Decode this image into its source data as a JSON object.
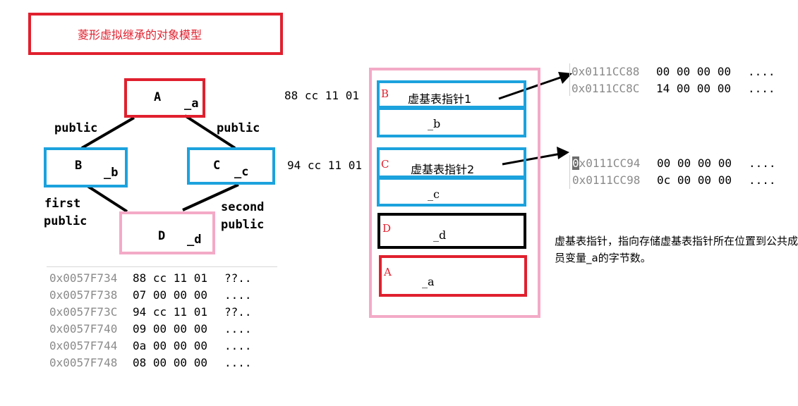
{
  "title": "菱形虚拟继承的对象模型",
  "hierarchy": {
    "A": {
      "name": "A",
      "member": "_a"
    },
    "B": {
      "name": "B",
      "member": "_b"
    },
    "C": {
      "name": "C",
      "member": "_c"
    },
    "D": {
      "name": "D",
      "member": "_d"
    },
    "edge_AB": "public",
    "edge_AC": "public",
    "edge_BD": [
      "first",
      "public"
    ],
    "edge_CD": [
      "second",
      "public"
    ]
  },
  "memory": [
    {
      "addr": "0x0057F734",
      "bytes": "88 cc 11 01",
      "ascii": "??.."
    },
    {
      "addr": "0x0057F738",
      "bytes": "07 00 00 00",
      "ascii": "...."
    },
    {
      "addr": "0x0057F73C",
      "bytes": "94 cc 11 01",
      "ascii": "??.."
    },
    {
      "addr": "0x0057F740",
      "bytes": "09 00 00 00",
      "ascii": "...."
    },
    {
      "addr": "0x0057F744",
      "bytes": "0a 00 00 00",
      "ascii": "...."
    },
    {
      "addr": "0x0057F748",
      "bytes": "08 00 00 00",
      "ascii": "...."
    }
  ],
  "object_layout": {
    "ptr1_value": "88 cc 11 01",
    "ptr2_value": "94 cc 11 01",
    "slots": [
      {
        "letter": "B",
        "text": "虚基表指针1"
      },
      {
        "letter": "",
        "text": "_b"
      },
      {
        "letter": "C",
        "text": "虚基表指针2"
      },
      {
        "letter": "",
        "text": "_c"
      },
      {
        "letter": "D",
        "text": "_d"
      },
      {
        "letter": "A",
        "text": "_a"
      }
    ]
  },
  "vtable1": [
    {
      "addr": "0x0111CC88",
      "bytes": "00 00 00 00",
      "ascii": "...."
    },
    {
      "addr": "0x0111CC8C",
      "bytes": "14 00 00 00",
      "ascii": "...."
    }
  ],
  "vtable2": [
    {
      "addr_first": "0",
      "addr_rest": "x0111CC94",
      "bytes": "00 00 00 00",
      "ascii": "...."
    },
    {
      "addr": "0x0111CC98",
      "bytes": "0c 00 00 00",
      "ascii": "...."
    }
  ],
  "note": "虚基表指针，指向存储虚基表指针所在位置到公共成员变量_a的字节数。",
  "colors": {
    "red": "#e0202e",
    "blue": "#1ca2dd",
    "pink": "#f4aac6",
    "black": "#000000"
  }
}
